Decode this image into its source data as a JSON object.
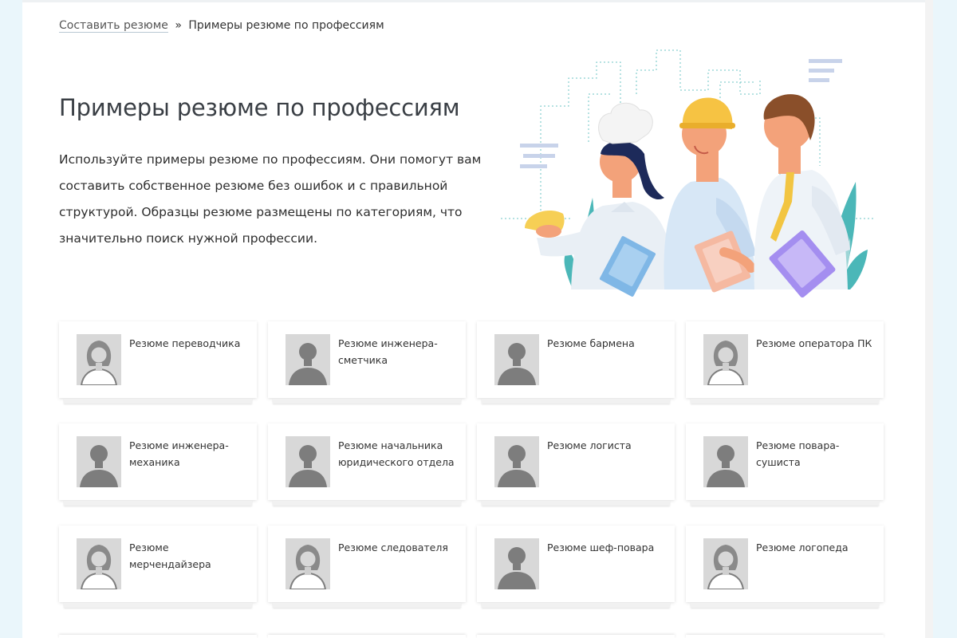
{
  "breadcrumb": {
    "link": "Составить резюме",
    "separator": "»",
    "current": "Примеры резюме по профессиям"
  },
  "page_title": "Примеры резюме по профессиям",
  "intro": "Используйте примеры резюме по профессиям. Они помогут вам составить собственное резюме без ошибок и с правильной структурой. Образцы резюме размещены по категориям, что значительно поиск нужной профессии.",
  "hero": {
    "icon": "professionals-illustration"
  },
  "cards": [
    {
      "label": "Резюме переводчика",
      "avatar": "female"
    },
    {
      "label": "Резюме инженера-сметчика",
      "avatar": "male"
    },
    {
      "label": "Резюме бармена",
      "avatar": "male"
    },
    {
      "label": "Резюме оператора ПК",
      "avatar": "female"
    },
    {
      "label": "Резюме инженера-механика",
      "avatar": "male"
    },
    {
      "label": "Резюме начальника юридического отдела",
      "avatar": "male"
    },
    {
      "label": "Резюме логиста",
      "avatar": "male"
    },
    {
      "label": "Резюме повара-сушиста",
      "avatar": "male"
    },
    {
      "label": "Резюме мерчендайзера",
      "avatar": "female"
    },
    {
      "label": "Резюме следователя",
      "avatar": "female"
    },
    {
      "label": "Резюме шеф-повара",
      "avatar": "male"
    },
    {
      "label": "Резюме логопеда",
      "avatar": "female"
    }
  ],
  "colors": {
    "background": "#eaf6fb",
    "accent_teal": "#4bb7b8",
    "avatar_bg": "#d8d8d8",
    "avatar_figure": "#7d7d7d"
  }
}
